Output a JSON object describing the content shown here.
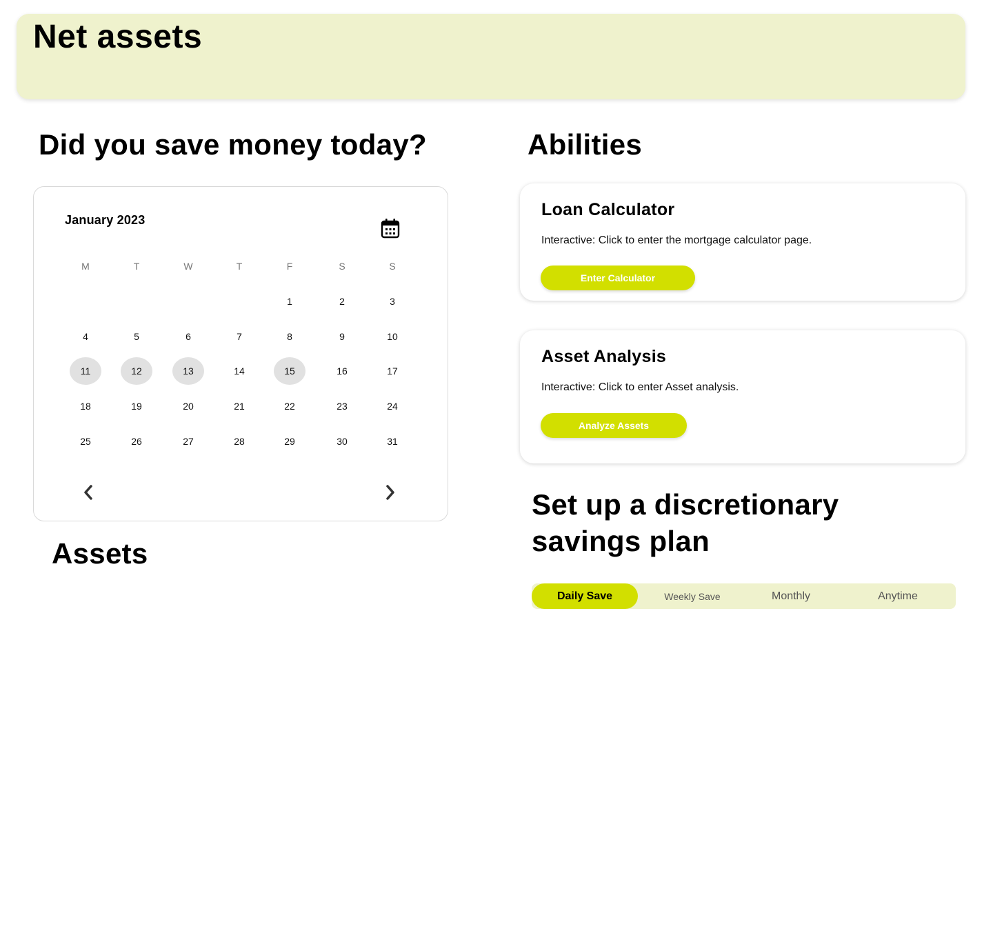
{
  "banner": {
    "title": "Net assets"
  },
  "savings_today": {
    "heading": "Did you save money today?",
    "calendar": {
      "month_label": "January 2023",
      "calendar_icon": "calendar-icon",
      "weekdays": [
        "M",
        "T",
        "W",
        "T",
        "F",
        "S",
        "S"
      ],
      "weeks": [
        [
          "",
          "",
          "",
          "",
          "1",
          "2",
          "3"
        ],
        [
          "4",
          "5",
          "6",
          "7",
          "8",
          "9",
          "10"
        ],
        [
          "11",
          "12",
          "13",
          "14",
          "15",
          "16",
          "17"
        ],
        [
          "18",
          "19",
          "20",
          "21",
          "22",
          "23",
          "24"
        ],
        [
          "25",
          "26",
          "27",
          "28",
          "29",
          "30",
          "31"
        ]
      ],
      "marked_days": [
        "11",
        "12",
        "13",
        "15"
      ],
      "prev_icon": "chevron-left-icon",
      "next_icon": "chevron-right-icon"
    }
  },
  "assets": {
    "heading": "Assets"
  },
  "abilities": {
    "heading": "Abilities",
    "cards": [
      {
        "title": "Loan Calculator",
        "description": "Interactive: Click to enter the mortgage calculator page.",
        "button_label": "Enter Calculator"
      },
      {
        "title": "Asset Analysis",
        "description": "Interactive: Click to enter Asset analysis.",
        "button_label": "Analyze Assets"
      }
    ]
  },
  "savings_plan": {
    "heading": "Set up a discretionary savings plan",
    "tabs": [
      "Daily Save",
      "Weekly Save",
      "Monthly",
      "Anytime"
    ],
    "active_tab": "Daily Save"
  },
  "colors": {
    "accent": "#d2df00",
    "banner_bg": "#eff2cd",
    "marked_day_bg": "#e1e1e1"
  }
}
